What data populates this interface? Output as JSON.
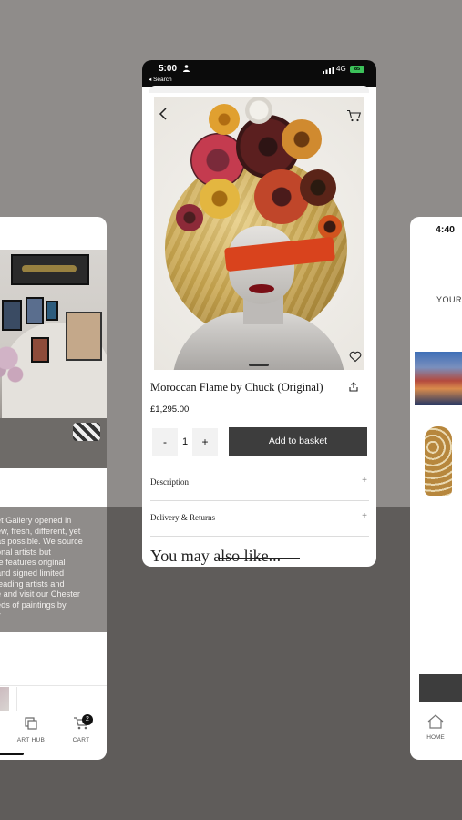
{
  "left_card": {
    "about_text": "et Gallery opened in\new, fresh, different, yet\nas possible. We source\nonal artists but\nte features original\nand signed limited\n leading artists and\ne and visit our Chester\neds of paintings by\ny",
    "nav": {
      "art_hub_label": "ART HUB",
      "cart_label": "CART",
      "cart_count": "2"
    }
  },
  "center_card": {
    "status_bar": {
      "time": "5:00",
      "back_label": "◂ Search",
      "network": "4G",
      "battery": "85"
    },
    "product": {
      "title": "Moroccan Flame by Chuck (Original)",
      "price": "£1,295.00"
    },
    "quantity": {
      "minus": "-",
      "value": "1",
      "plus": "+"
    },
    "add_to_basket_label": "Add to basket",
    "accordion": [
      {
        "label": "Description",
        "toggle": "+"
      },
      {
        "label": "Delivery & Returns",
        "toggle": "+"
      }
    ],
    "section_heading": "You may also like..."
  },
  "right_card": {
    "time": "4:40",
    "heading_partial": "YOUR",
    "nav": {
      "home_label": "HOME"
    }
  }
}
